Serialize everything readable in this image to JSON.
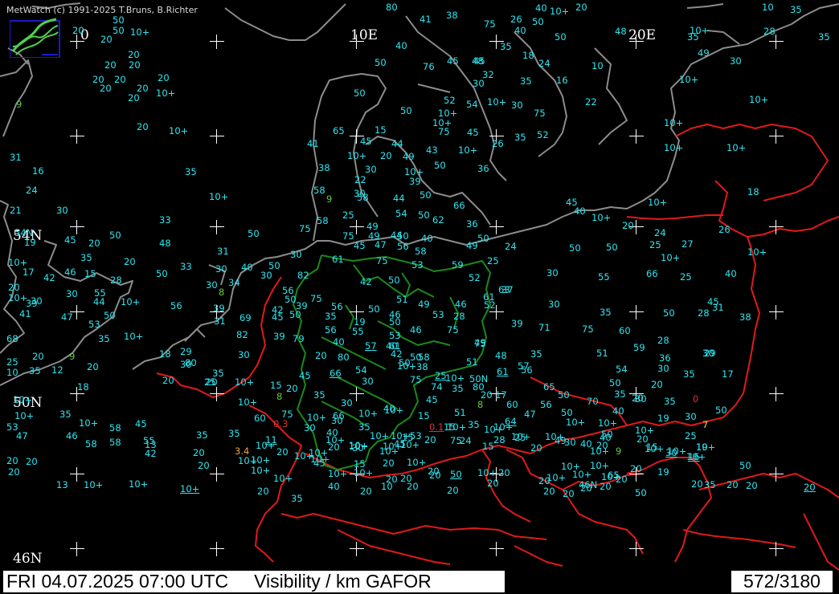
{
  "app": {
    "copyright": "MetWatch  (c) 1991-2025 T.Bruns, B.Richter"
  },
  "status": {
    "datetime": "FRI 04.07.2025 07:00 UTC",
    "product": "Visibility / km GAFOR",
    "count": "572/3180"
  },
  "grid_labels": {
    "lon_0": "0",
    "lon_10e": "10E",
    "lon_20e": "20E",
    "lat_54n": "54N",
    "lat_50n": "50N",
    "lat_46n": "46N"
  },
  "colors": {
    "background": "#000000",
    "coast": "#909090",
    "border": "#e02020",
    "germany_border": "#1a8a1a",
    "value": "#2ee6f0"
  },
  "logo_icon": "metwatch-logo-icon",
  "observations": [
    {
      "v": "80"
    },
    {
      "v": "41"
    },
    {
      "v": "38"
    },
    {
      "v": "26"
    },
    {
      "v": "40"
    },
    {
      "v": "10+"
    },
    {
      "v": "20"
    },
    {
      "v": "50"
    },
    {
      "v": "20"
    },
    {
      "v": "50"
    },
    {
      "v": "10+"
    },
    {
      "v": "75"
    },
    {
      "v": "20"
    },
    {
      "v": "50"
    },
    {
      "v": "40"
    },
    {
      "v": "50"
    },
    {
      "v": "48"
    },
    {
      "v": "10+"
    },
    {
      "v": "28"
    },
    {
      "v": "10"
    },
    {
      "v": "35"
    },
    {
      "v": "35"
    },
    {
      "v": "40"
    },
    {
      "v": "45"
    },
    {
      "v": "35"
    },
    {
      "v": "18"
    },
    {
      "v": "30"
    },
    {
      "v": "35"
    },
    {
      "v": "20"
    },
    {
      "v": "20"
    },
    {
      "v": "20"
    },
    {
      "v": "49"
    },
    {
      "v": "50"
    },
    {
      "v": "76"
    },
    {
      "v": "45"
    },
    {
      "v": "48"
    },
    {
      "v": "24"
    },
    {
      "v": "10"
    },
    {
      "v": "20"
    },
    {
      "v": "20"
    },
    {
      "v": "20"
    },
    {
      "v": "20"
    },
    {
      "v": "20"
    },
    {
      "v": "10+"
    },
    {
      "v": "32"
    },
    {
      "v": "30"
    },
    {
      "v": "35"
    },
    {
      "v": "16"
    },
    {
      "v": "10+"
    },
    {
      "v": "20"
    },
    {
      "v": "50"
    },
    {
      "v": "52"
    },
    {
      "v": "54"
    },
    {
      "v": "10+"
    },
    {
      "v": "30"
    },
    {
      "v": "22"
    },
    {
      "v": "10+"
    },
    {
      "v": "9",
      "c": "green"
    },
    {
      "v": "50"
    },
    {
      "v": "10+"
    },
    {
      "v": "75"
    },
    {
      "v": "20"
    },
    {
      "v": "10+"
    },
    {
      "v": "65"
    },
    {
      "v": "15"
    },
    {
      "v": "75"
    },
    {
      "v": "45"
    },
    {
      "v": "52"
    },
    {
      "v": "10+"
    },
    {
      "v": "35"
    },
    {
      "v": "10+"
    },
    {
      "v": "45"
    },
    {
      "v": "44"
    },
    {
      "v": "10+"
    },
    {
      "v": "41"
    },
    {
      "v": "26"
    },
    {
      "v": "10+"
    },
    {
      "v": "10+"
    },
    {
      "v": "31"
    },
    {
      "v": "20"
    },
    {
      "v": "49"
    },
    {
      "v": "43"
    },
    {
      "v": "10+"
    },
    {
      "v": "50"
    },
    {
      "v": "36"
    },
    {
      "v": "16"
    },
    {
      "v": "30"
    },
    {
      "v": "10+"
    },
    {
      "v": "35"
    },
    {
      "v": "24"
    },
    {
      "v": "38"
    },
    {
      "v": "22"
    },
    {
      "v": "39"
    },
    {
      "v": "58"
    },
    {
      "v": "30"
    },
    {
      "v": "50"
    },
    {
      "v": "18"
    },
    {
      "v": "10+"
    },
    {
      "v": "30"
    },
    {
      "v": "9",
      "c": "green"
    },
    {
      "v": "58"
    },
    {
      "v": "44"
    },
    {
      "v": "66"
    },
    {
      "v": "54"
    },
    {
      "v": "50"
    },
    {
      "v": "45"
    },
    {
      "v": "40"
    },
    {
      "v": "10+"
    },
    {
      "v": "21"
    },
    {
      "v": "25"
    },
    {
      "v": "62"
    },
    {
      "v": "10+"
    },
    {
      "v": "33"
    },
    {
      "v": "58"
    },
    {
      "v": "49"
    },
    {
      "v": "36"
    },
    {
      "v": "75"
    },
    {
      "v": "49"
    },
    {
      "v": "50"
    },
    {
      "v": "20"
    },
    {
      "v": "24"
    },
    {
      "v": "26"
    },
    {
      "v": "54N"
    },
    {
      "v": "50"
    },
    {
      "v": "75"
    },
    {
      "v": "44"
    },
    {
      "v": "40"
    },
    {
      "v": "50"
    },
    {
      "v": "45"
    },
    {
      "v": "20"
    },
    {
      "v": "50"
    },
    {
      "v": "48"
    },
    {
      "v": "45"
    },
    {
      "v": "47"
    },
    {
      "v": "56"
    },
    {
      "v": "58"
    },
    {
      "v": "24"
    },
    {
      "v": "50"
    },
    {
      "v": "50"
    },
    {
      "v": "25"
    },
    {
      "v": "27"
    },
    {
      "v": "19"
    },
    {
      "v": "31"
    },
    {
      "v": "49"
    },
    {
      "v": "30"
    },
    {
      "v": "61"
    },
    {
      "v": "75"
    },
    {
      "v": "53"
    },
    {
      "v": "59"
    },
    {
      "v": "25"
    },
    {
      "v": "10+"
    },
    {
      "v": "10+"
    },
    {
      "v": "35"
    },
    {
      "v": "20"
    },
    {
      "v": "33"
    },
    {
      "v": "30"
    },
    {
      "v": "40"
    },
    {
      "v": "50"
    },
    {
      "v": "52"
    },
    {
      "v": "10+"
    },
    {
      "v": "17"
    },
    {
      "v": "42"
    },
    {
      "v": "46"
    },
    {
      "v": "15"
    },
    {
      "v": "50"
    },
    {
      "v": "30"
    },
    {
      "v": "82"
    },
    {
      "v": "63"
    },
    {
      "v": "30"
    },
    {
      "v": "55"
    },
    {
      "v": "66"
    },
    {
      "v": "25"
    },
    {
      "v": "40"
    },
    {
      "v": "30"
    },
    {
      "v": "20"
    },
    {
      "v": "28"
    },
    {
      "v": "34"
    },
    {
      "v": "56"
    },
    {
      "v": "42"
    },
    {
      "v": "50"
    },
    {
      "v": "61"
    },
    {
      "v": "37"
    },
    {
      "v": "30"
    },
    {
      "v": "55"
    },
    {
      "v": "44"
    },
    {
      "v": "10+"
    },
    {
      "v": "8",
      "c": "green"
    },
    {
      "v": "50"
    },
    {
      "v": "75"
    },
    {
      "v": "51"
    },
    {
      "v": "49"
    },
    {
      "v": "46"
    },
    {
      "v": "52"
    },
    {
      "v": "30"
    },
    {
      "v": "45"
    },
    {
      "v": "30"
    },
    {
      "v": "10+"
    },
    {
      "v": "31"
    },
    {
      "v": "39"
    },
    {
      "v": "42"
    },
    {
      "v": "39"
    },
    {
      "v": "56"
    },
    {
      "v": "50"
    },
    {
      "v": "46"
    },
    {
      "v": "53"
    },
    {
      "v": "28"
    },
    {
      "v": "35"
    },
    {
      "v": "50"
    },
    {
      "v": "28"
    },
    {
      "v": "38"
    },
    {
      "v": "41"
    },
    {
      "v": "47"
    },
    {
      "v": "50"
    },
    {
      "v": "56"
    },
    {
      "v": "39"
    },
    {
      "v": "69"
    },
    {
      "v": "45"
    },
    {
      "v": "50"
    },
    {
      "v": "35"
    },
    {
      "v": "19"
    },
    {
      "v": "50"
    },
    {
      "v": "46"
    },
    {
      "v": "75"
    },
    {
      "v": "39"
    },
    {
      "v": "71"
    },
    {
      "v": "75"
    },
    {
      "v": "60"
    },
    {
      "v": "53"
    },
    {
      "v": "10+"
    },
    {
      "v": "31"
    },
    {
      "v": "82"
    },
    {
      "v": "39"
    },
    {
      "v": "56"
    },
    {
      "v": "55"
    },
    {
      "v": "53"
    },
    {
      "v": "61"
    },
    {
      "v": "75"
    },
    {
      "v": "28"
    },
    {
      "v": "30"
    },
    {
      "v": "36"
    },
    {
      "v": "68"
    },
    {
      "v": "35"
    },
    {
      "v": "30"
    },
    {
      "v": "79"
    },
    {
      "v": "40"
    },
    {
      "v": "57",
      "u": true
    },
    {
      "v": "40"
    },
    {
      "v": "49"
    },
    {
      "v": "51"
    },
    {
      "v": "59"
    },
    {
      "v": "29"
    },
    {
      "v": "20"
    },
    {
      "v": "9",
      "c": "green"
    },
    {
      "v": "29"
    },
    {
      "v": "18"
    },
    {
      "v": "80"
    },
    {
      "v": "20"
    },
    {
      "v": "80"
    },
    {
      "v": "42"
    },
    {
      "v": "50"
    },
    {
      "v": "58"
    },
    {
      "v": "48"
    },
    {
      "v": "35"
    },
    {
      "v": "25"
    },
    {
      "v": "35"
    },
    {
      "v": "12"
    },
    {
      "v": "20"
    },
    {
      "v": "30"
    },
    {
      "v": "20"
    },
    {
      "v": "10+"
    },
    {
      "v": "20"
    },
    {
      "v": "50"
    },
    {
      "v": "38"
    },
    {
      "v": "51"
    },
    {
      "v": "61",
      "u": true
    },
    {
      "v": "57"
    },
    {
      "v": "54"
    },
    {
      "v": "30"
    },
    {
      "v": "35"
    },
    {
      "v": "17"
    },
    {
      "v": "10"
    },
    {
      "v": "35"
    },
    {
      "v": "20"
    },
    {
      "v": "25"
    },
    {
      "v": "45"
    },
    {
      "v": "66",
      "u": true
    },
    {
      "v": "54"
    },
    {
      "v": "10+"
    },
    {
      "v": "25",
      "u": true
    },
    {
      "v": "10+"
    },
    {
      "v": "50N"
    },
    {
      "v": "80"
    },
    {
      "v": "56"
    },
    {
      "v": "65"
    },
    {
      "v": "50"
    },
    {
      "v": "20"
    },
    {
      "v": "18"
    },
    {
      "v": "15"
    },
    {
      "v": "8",
      "c": "green"
    },
    {
      "v": "35"
    },
    {
      "v": "30"
    },
    {
      "v": "75"
    },
    {
      "v": "74"
    },
    {
      "v": "35"
    },
    {
      "v": "20"
    },
    {
      "v": "17"
    },
    {
      "v": "8",
      "c": "green"
    },
    {
      "v": "50"
    },
    {
      "v": "35"
    },
    {
      "v": "20"
    },
    {
      "v": "10+"
    },
    {
      "v": "10+"
    },
    {
      "v": "30"
    },
    {
      "v": "40"
    },
    {
      "v": "45"
    },
    {
      "v": "60"
    },
    {
      "v": "56"
    },
    {
      "v": "70"
    },
    {
      "v": "30"
    },
    {
      "v": "35"
    },
    {
      "v": "0",
      "c": "red"
    },
    {
      "v": "35"
    },
    {
      "v": "66"
    },
    {
      "v": "10+"
    },
    {
      "v": "10+"
    },
    {
      "v": "51"
    },
    {
      "v": "64",
      "u": true
    },
    {
      "v": "47"
    },
    {
      "v": "50"
    },
    {
      "v": "40"
    },
    {
      "v": "19"
    },
    {
      "v": "30"
    },
    {
      "v": "7",
      "c": "yellow"
    },
    {
      "v": "50"
    },
    {
      "v": "10+"
    },
    {
      "v": "10+"
    },
    {
      "v": "58"
    },
    {
      "v": "45"
    },
    {
      "v": "60"
    },
    {
      "v": "75"
    },
    {
      "v": "10+"
    },
    {
      "v": "30"
    },
    {
      "v": "35"
    },
    {
      "v": "15"
    },
    {
      "v": "0.1",
      "c": "red",
      "u": true
    },
    {
      "v": "35"
    },
    {
      "v": "10+"
    },
    {
      "v": "10+"
    },
    {
      "v": "10+"
    },
    {
      "v": "10+"
    },
    {
      "v": "47"
    },
    {
      "v": "58"
    },
    {
      "v": "55"
    },
    {
      "v": "0.3",
      "c": "red"
    },
    {
      "v": "30"
    },
    {
      "v": "40"
    },
    {
      "v": "10+"
    },
    {
      "v": "15"
    },
    {
      "v": "15"
    },
    {
      "v": "10+"
    },
    {
      "v": "10+"
    },
    {
      "v": "10+"
    },
    {
      "v": "10+"
    },
    {
      "v": "50"
    },
    {
      "v": "53"
    },
    {
      "v": "46"
    },
    {
      "v": "58"
    },
    {
      "v": "13"
    },
    {
      "v": "35"
    },
    {
      "v": "35"
    },
    {
      "v": "10+"
    },
    {
      "v": "11",
      "u": true
    },
    {
      "v": "10+"
    },
    {
      "v": "10+"
    },
    {
      "v": "10+"
    },
    {
      "v": "45"
    },
    {
      "v": "53"
    },
    {
      "v": "28"
    },
    {
      "v": "25"
    },
    {
      "v": "49"
    },
    {
      "v": "40"
    },
    {
      "v": "20"
    },
    {
      "v": "20"
    },
    {
      "v": "25"
    },
    {
      "v": "10+"
    },
    {
      "v": "20"
    },
    {
      "v": "10+"
    },
    {
      "v": "10+"
    },
    {
      "v": "20"
    },
    {
      "v": "24"
    },
    {
      "v": "15"
    },
    {
      "v": "20"
    },
    {
      "v": "30"
    },
    {
      "v": "40"
    },
    {
      "v": "10+"
    },
    {
      "v": "10+"
    },
    {
      "v": "16",
      "u": true
    },
    {
      "v": "42"
    },
    {
      "v": "20"
    },
    {
      "v": "3.4",
      "c": "orange"
    },
    {
      "v": "20"
    },
    {
      "v": "10+"
    },
    {
      "v": "30"
    },
    {
      "v": "10+"
    },
    {
      "v": "10+"
    },
    {
      "v": "75"
    },
    {
      "v": "10+"
    },
    {
      "v": "9",
      "c": "green"
    },
    {
      "v": "15"
    },
    {
      "v": "19"
    },
    {
      "v": "20"
    },
    {
      "v": "20"
    },
    {
      "v": "20"
    },
    {
      "v": "10+"
    },
    {
      "v": "10+"
    },
    {
      "v": "10+"
    },
    {
      "v": "30",
      "u": true
    },
    {
      "v": "10+"
    },
    {
      "v": "45"
    },
    {
      "v": "15"
    },
    {
      "v": "20"
    },
    {
      "v": "10+"
    },
    {
      "v": "20"
    },
    {
      "v": "10+"
    },
    {
      "v": "10+"
    },
    {
      "v": "10+"
    },
    {
      "v": "10+"
    },
    {
      "v": "10+"
    },
    {
      "v": "65"
    },
    {
      "v": "20"
    },
    {
      "v": "19"
    },
    {
      "v": "50"
    },
    {
      "v": "20"
    },
    {
      "v": "10+"
    },
    {
      "v": "10+"
    },
    {
      "v": "10+"
    },
    {
      "v": "10+"
    },
    {
      "v": "10+"
    },
    {
      "v": "20"
    },
    {
      "v": "20"
    },
    {
      "v": "20"
    },
    {
      "v": "20"
    },
    {
      "v": "50",
      "u": true
    },
    {
      "v": "20"
    },
    {
      "v": "20"
    },
    {
      "v": "20"
    },
    {
      "v": "46N"
    },
    {
      "v": "10+"
    },
    {
      "v": "20"
    },
    {
      "v": "20"
    },
    {
      "v": "13"
    },
    {
      "v": "10+"
    },
    {
      "v": "10+"
    },
    {
      "v": "10+",
      "u": true
    },
    {
      "v": "20"
    },
    {
      "v": "35"
    },
    {
      "v": "40"
    },
    {
      "v": "20"
    },
    {
      "v": "10"
    },
    {
      "v": "20"
    },
    {
      "v": "20"
    },
    {
      "v": "20"
    },
    {
      "v": "20"
    },
    {
      "v": "20"
    },
    {
      "v": "50"
    },
    {
      "v": "35"
    },
    {
      "v": "20"
    },
    {
      "v": "20"
    },
    {
      "v": "20",
      "u": true
    }
  ]
}
